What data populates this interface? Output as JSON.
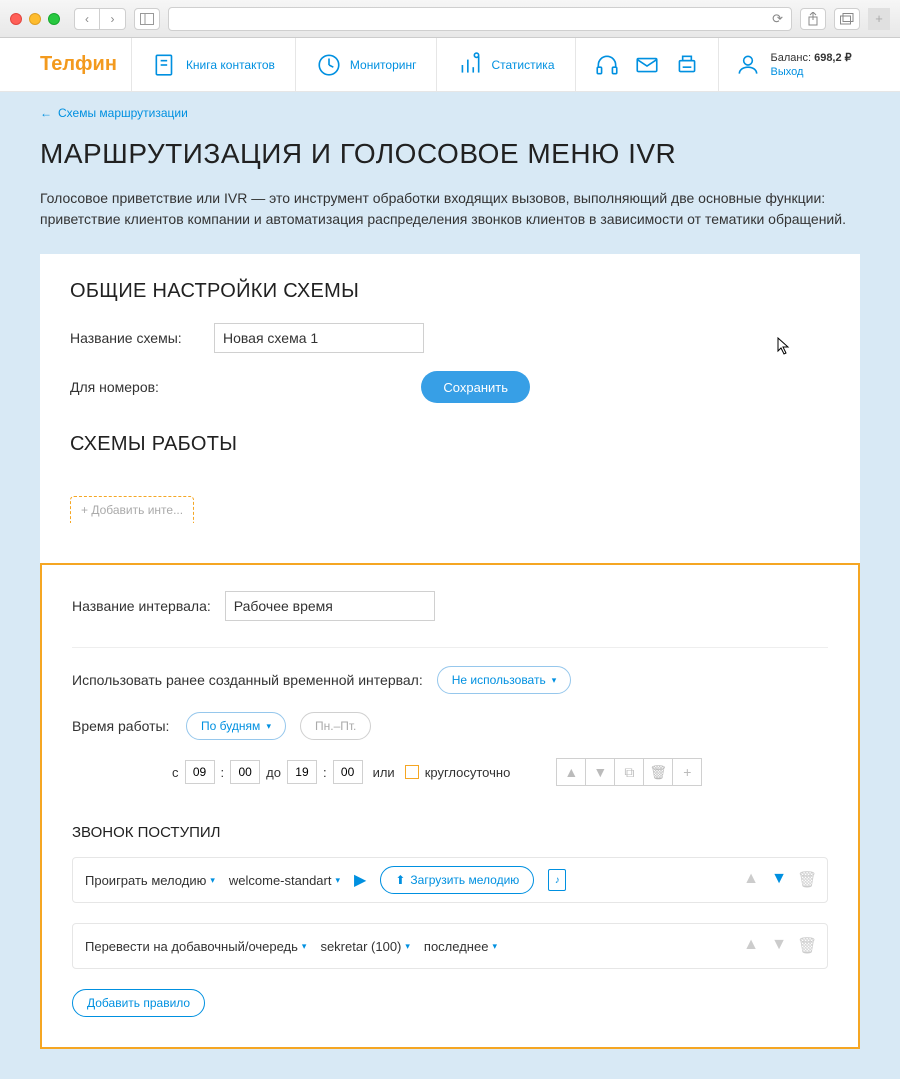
{
  "nav": {
    "logo": "Телфин",
    "contacts": "Книга контактов",
    "monitoring": "Мониторинг",
    "stats": "Статистика",
    "balance_label": "Баланс:",
    "balance_value": "698,2 ₽",
    "logout": "Выход"
  },
  "back_link": "Схемы маршрутизации",
  "page_title": "МАРШРУТИЗАЦИЯ И ГОЛОСОВОЕ МЕНЮ IVR",
  "page_desc": "Голосовое приветствие или IVR — это инструмент обработки входящих вызовов, выполняющий две основные функции: приветствие клиентов компании и автоматизация распределения звонков клиентов в зависимости от тематики обращений.",
  "section_general": "ОБЩИЕ НАСТРОЙКИ СХЕМЫ",
  "scheme_name_label": "Название схемы:",
  "scheme_name_value": "Новая схема 1",
  "for_numbers_label": "Для номеров:",
  "save_btn": "Сохранить",
  "section_schemes": "СХЕМЫ РАБОТЫ",
  "add_tab": "+ Добавить инте...",
  "interval_name_label": "Название интервала:",
  "interval_name_value": "Рабочее время",
  "use_prev_label": "Использовать ранее созданный временной интервал:",
  "use_prev_value": "Не использовать",
  "work_time_label": "Время работы:",
  "weekdays_value": "По будням",
  "weekdays_short": "Пн.–Пт.",
  "time_from_label": "с",
  "time_from_h": "09",
  "time_from_m": "00",
  "time_to_label": "до",
  "time_to_h": "19",
  "time_to_m": "00",
  "or_label": "или",
  "allday_label": "круглосуточно",
  "section_call": "ЗВОНОК ПОСТУПИЛ",
  "rule1_action": "Проиграть мелодию",
  "rule1_file": "welcome-standart",
  "rule1_upload": "Загрузить мелодию",
  "rule2_action": "Перевести на добавочный/очередь",
  "rule2_target": "sekretar (100)",
  "rule2_mode": "последнее",
  "add_rule_btn": "Добавить правило"
}
